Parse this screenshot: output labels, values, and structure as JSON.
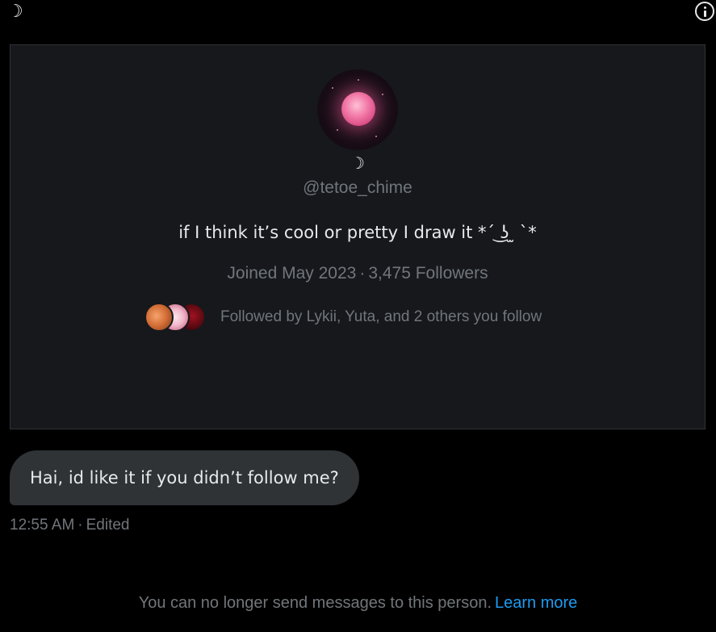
{
  "header": {
    "display_name": "☽",
    "info_icon": "info-circle-icon"
  },
  "profile": {
    "avatar": "pink-moon-avatar",
    "display_name": "☽",
    "handle": "@tetoe_chime",
    "bio": "if I think it’s cool or pretty I draw it *´ ͜ʖ ̫ `*",
    "joined": "Joined May 2023",
    "separator": "·",
    "followers": "3,475 Followers",
    "followed_by": "Followed by Lykii, Yuta, and 2 others you follow"
  },
  "message": {
    "text": "Hai, id like it if you didn’t follow me?",
    "time": "12:55 AM",
    "separator": "·",
    "status": "Edited"
  },
  "notice": {
    "text": "You can no longer send messages to this person.",
    "link": "Learn more"
  },
  "colors": {
    "background": "#000000",
    "card": "#16181c",
    "bubble": "#2f3336",
    "muted": "#71767b",
    "link": "#1d9bf0",
    "text": "#e7e9ea"
  }
}
